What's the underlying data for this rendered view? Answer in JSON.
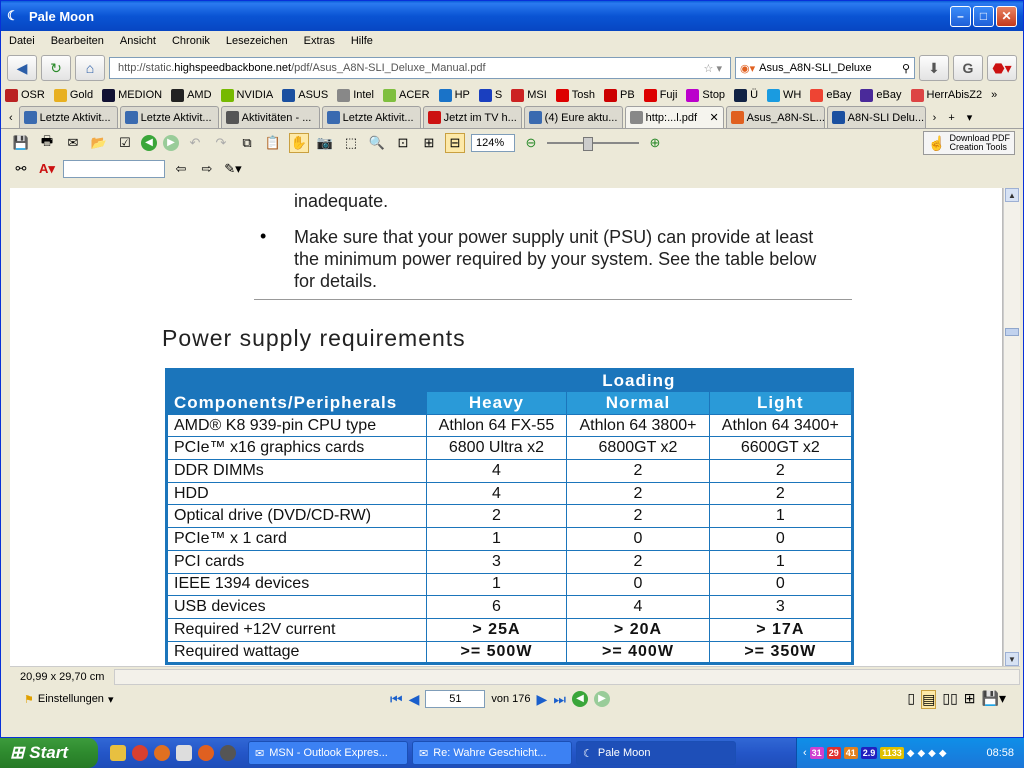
{
  "window": {
    "title": "Pale Moon"
  },
  "menu": [
    "Datei",
    "Bearbeiten",
    "Ansicht",
    "Chronik",
    "Lesezeichen",
    "Extras",
    "Hilfe"
  ],
  "nav": {
    "url_prefix": "http://static.",
    "url_domain": "highspeedbackbone.net",
    "url_path": "/pdf/Asus_A8N-SLI_Deluxe_Manual.pdf",
    "search_value": "Asus_A8N-SLI_Deluxe"
  },
  "bookmarks": [
    {
      "label": "OSR",
      "color": "#b22"
    },
    {
      "label": "Gold",
      "color": "#e8b020"
    },
    {
      "label": "MEDION",
      "color": "#113"
    },
    {
      "label": "AMD",
      "color": "#222"
    },
    {
      "label": "NVIDIA",
      "color": "#76b900"
    },
    {
      "label": "ASUS",
      "color": "#1a4fa0"
    },
    {
      "label": "Intel",
      "color": "#888"
    },
    {
      "label": "ACER",
      "color": "#7fbf3f"
    },
    {
      "label": "HP",
      "color": "#1a73c8"
    },
    {
      "label": "S",
      "color": "#1a3fbf"
    },
    {
      "label": "MSI",
      "color": "#c22"
    },
    {
      "label": "Tosh",
      "color": "#d00"
    },
    {
      "label": "PB",
      "color": "#c00"
    },
    {
      "label": "Fuji",
      "color": "#d00"
    },
    {
      "label": "Stop",
      "color": "#b0c"
    },
    {
      "label": "Ü",
      "color": "#124"
    },
    {
      "label": "WH",
      "color": "#1a9be0"
    },
    {
      "label": "eBay",
      "color": "#e43"
    },
    {
      "label": "eBay",
      "color": "#4a2a9a"
    },
    {
      "label": "HerrAbisZ2",
      "color": "#d44"
    }
  ],
  "tabs": [
    {
      "label": "Letzte Aktivit...",
      "color": "#3a6ab0"
    },
    {
      "label": "Letzte Aktivit...",
      "color": "#3a6ab0"
    },
    {
      "label": "Aktivitäten - ...",
      "color": "#555"
    },
    {
      "label": "Letzte Aktivit...",
      "color": "#3a6ab0"
    },
    {
      "label": "Jetzt im TV h...",
      "color": "#c11"
    },
    {
      "label": "(4) Eure aktu...",
      "color": "#3a6ab0"
    },
    {
      "label": "http:...l.pdf",
      "color": "#888",
      "active": true
    },
    {
      "label": "Asus_A8N-SL...",
      "color": "#e06020"
    },
    {
      "label": "A8N-SLI Delu...",
      "color": "#1a4fa0"
    }
  ],
  "pdf_toolbar": {
    "zoom": "124%",
    "download_line1": "Download PDF",
    "download_line2": "Creation Tools"
  },
  "document": {
    "line1": "inadequate.",
    "bullet_line1": "Make sure that your power supply unit (PSU) can provide at least",
    "bullet_line2": "the minimum power required by your system. See the table below",
    "bullet_line3": "for details.",
    "section_title": "Power supply requirements",
    "table": {
      "header_loading": "Loading",
      "header_components": "Components/Peripherals",
      "header_cols": [
        "Heavy",
        "Normal",
        "Light"
      ],
      "rows": [
        [
          "AMD® K8 939-pin CPU type",
          "Athlon 64 FX-55",
          "Athlon 64 3800+",
          "Athlon 64 3400+"
        ],
        [
          "PCIe™ x16 graphics cards",
          "6800 Ultra x2",
          "6800GT x2",
          "6600GT x2"
        ],
        [
          "DDR DIMMs",
          "4",
          "2",
          "2"
        ],
        [
          "HDD",
          "4",
          "2",
          "2"
        ],
        [
          "Optical drive (DVD/CD-RW)",
          "2",
          "2",
          "1"
        ],
        [
          "PCIe™ x 1 card",
          "1",
          "0",
          "0"
        ],
        [
          "PCI cards",
          "3",
          "2",
          "1"
        ],
        [
          "IEEE 1394 devices",
          "1",
          "0",
          "0"
        ],
        [
          "USB devices",
          "6",
          "4",
          "3"
        ],
        [
          "Required +12V current",
          "> 25A",
          "> 20A",
          "> 17A"
        ],
        [
          "Required wattage",
          ">= 500W",
          ">= 400W",
          ">= 350W"
        ]
      ]
    }
  },
  "status": {
    "page_size": "20,99 x 29,70 cm",
    "settings": "Einstellungen",
    "page_current": "51",
    "page_total": "von 176"
  },
  "taskbar": {
    "start": "Start",
    "tasks": [
      "MSN - Outlook Expres...",
      "Re: Wahre Geschicht...",
      "Pale Moon"
    ],
    "tray_badges": [
      {
        "label": "31",
        "color": "#d040d0"
      },
      {
        "label": "29",
        "color": "#e03030"
      },
      {
        "label": "41",
        "color": "#e08020"
      },
      {
        "label": "2.9",
        "color": "#2020c0"
      },
      {
        "label": "1133",
        "color": "#e0c000"
      }
    ],
    "clock": "08:58"
  }
}
